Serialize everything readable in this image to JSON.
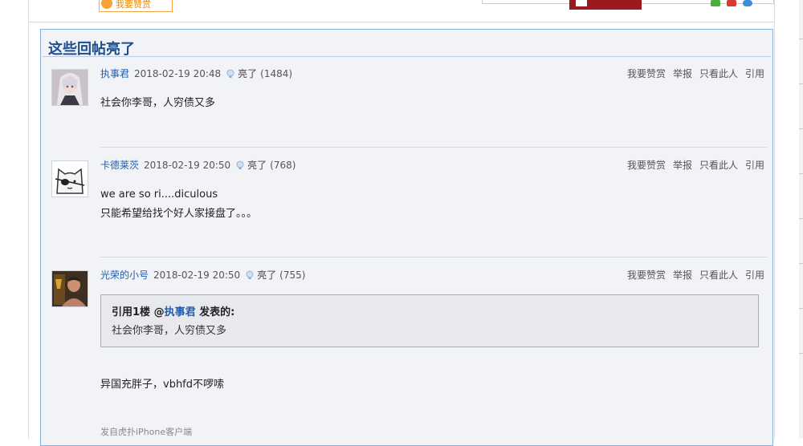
{
  "top_strip": {
    "reward_label": "我要赞赏"
  },
  "panel": {
    "title": "这些回帖亮了"
  },
  "actions": {
    "reward": "我要赞赏",
    "report": "举报",
    "only_author": "只看此人",
    "quote": "引用"
  },
  "posts": [
    {
      "user": "执事君",
      "time": "2018-02-19 20:48",
      "lit_label": "亮了",
      "lit_count": "(1484)",
      "lines": [
        "社会你李哥，人穷债又多"
      ]
    },
    {
      "user": "卡德莱茨",
      "time": "2018-02-19 20:50",
      "lit_label": "亮了",
      "lit_count": "(768)",
      "lines": [
        "we are so ri....diculous",
        "只能希望给找个好人家接盘了。。。"
      ]
    },
    {
      "user": "光荣的小号",
      "time": "2018-02-19 20:50",
      "lit_label": "亮了",
      "lit_count": "(755)",
      "quote": {
        "prefix": "引用1楼 @",
        "user": "执事君",
        "suffix": " 发表的:",
        "text": "社会你李哥，人穷债又多"
      },
      "lines": [
        "异国充胖子，vbhfd不啰嗦"
      ],
      "source": "发自虎扑iPhone客户端"
    }
  ],
  "colors": {
    "link_blue": "#1f5cb3",
    "panel_bg": "#f1f3f6",
    "panel_border": "#88b0d9",
    "reward_orange": "#f08a00"
  }
}
